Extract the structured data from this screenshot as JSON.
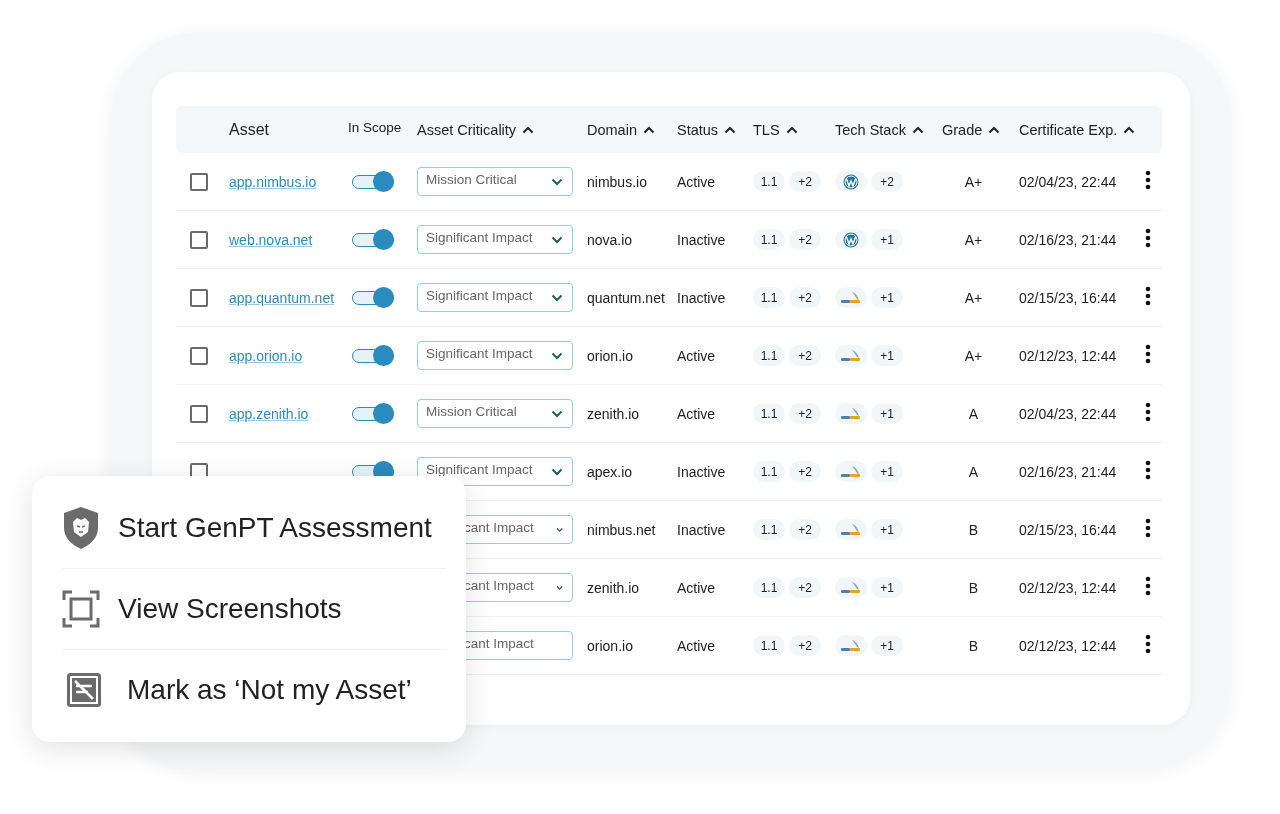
{
  "table": {
    "columns": [
      {
        "label": "Asset",
        "sortable": false
      },
      {
        "label": "In Scope",
        "sortable": false
      },
      {
        "label": "Asset Criticality",
        "sortable": true
      },
      {
        "label": "Domain",
        "sortable": true
      },
      {
        "label": "Status",
        "sortable": true
      },
      {
        "label": "TLS",
        "sortable": true
      },
      {
        "label": "Tech Stack",
        "sortable": true
      },
      {
        "label": "Grade",
        "sortable": true
      },
      {
        "label": "Certificate Exp.",
        "sortable": true
      }
    ],
    "rows": [
      {
        "checked": false,
        "asset": "app.nimbus.io",
        "in_scope": true,
        "criticality": "Mission Critical",
        "chevron": true,
        "domain": "nimbus.io",
        "status": "Active",
        "tls": [
          "1.1",
          "+2"
        ],
        "tech": {
          "kind": "wordpress",
          "more": "+2"
        },
        "grade": "A+",
        "cert": "02/04/23, 22:44"
      },
      {
        "checked": false,
        "asset": "web.nova.net",
        "in_scope": true,
        "criticality": "Significant Impact",
        "chevron": true,
        "domain": "nova.io",
        "status": "Inactive",
        "tls": [
          "1.1",
          "+2"
        ],
        "tech": {
          "kind": "wordpress",
          "more": "+1"
        },
        "grade": "A+",
        "cert": "02/16/23, 21:44"
      },
      {
        "checked": false,
        "asset": "app.quantum.net",
        "in_scope": true,
        "criticality": "Significant Impact",
        "chevron": true,
        "domain": "quantum.net",
        "status": "Inactive",
        "tls": [
          "1.1",
          "+2"
        ],
        "tech": {
          "kind": "mysql",
          "more": "+1"
        },
        "grade": "A+",
        "cert": "02/15/23, 16:44"
      },
      {
        "checked": false,
        "asset": "app.orion.io",
        "in_scope": true,
        "criticality": "Significant Impact",
        "chevron": true,
        "domain": "orion.io",
        "status": "Active",
        "tls": [
          "1.1",
          "+2"
        ],
        "tech": {
          "kind": "mysql",
          "more": "+1"
        },
        "grade": "A+",
        "cert": "02/12/23, 12:44"
      },
      {
        "checked": false,
        "asset": "app.zenith.io",
        "in_scope": true,
        "criticality": "Mission Critical",
        "chevron": true,
        "domain": "zenith.io",
        "status": "Active",
        "tls": [
          "1.1",
          "+2"
        ],
        "tech": {
          "kind": "mysql",
          "more": "+1"
        },
        "grade": "A",
        "cert": "02/04/23, 22:44"
      },
      {
        "checked": false,
        "in_scope": true,
        "criticality": "Significant Impact",
        "chevron": true,
        "domain": "apex.io",
        "status": "Inactive",
        "tls": [
          "1.1",
          "+2"
        ],
        "tech": {
          "kind": "mysql",
          "more": "+1"
        },
        "grade": "A",
        "cert": "02/16/23, 21:44"
      },
      {
        "criticality": "cant Impact",
        "chevron": true,
        "domain": "nimbus.net",
        "status": "Inactive",
        "tls": [
          "1.1",
          "+2"
        ],
        "tech": {
          "kind": "mysql",
          "more": "+1"
        },
        "grade": "B",
        "cert": "02/15/23, 16:44"
      },
      {
        "criticality": "cant Impact",
        "chevron": true,
        "domain": "zenith.io",
        "status": "Active",
        "tls": [
          "1.1",
          "+2"
        ],
        "tech": {
          "kind": "mysql",
          "more": "+1"
        },
        "grade": "B",
        "cert": "02/12/23, 12:44"
      },
      {
        "criticality": "cant Impact",
        "chevron": false,
        "domain": "orion.io",
        "status": "Active",
        "tls": [
          "1.1",
          "+2"
        ],
        "tech": {
          "kind": "mysql",
          "more": "+1"
        },
        "grade": "B",
        "cert": "02/12/23, 12:44"
      }
    ]
  },
  "context_menu": {
    "items": [
      {
        "kind": "shield",
        "label": "Start GenPT Assessment"
      },
      {
        "kind": "screenshot",
        "label": "View Screenshots"
      },
      {
        "kind": "not-asset",
        "label": "Mark as ‘Not my Asset’"
      }
    ]
  }
}
